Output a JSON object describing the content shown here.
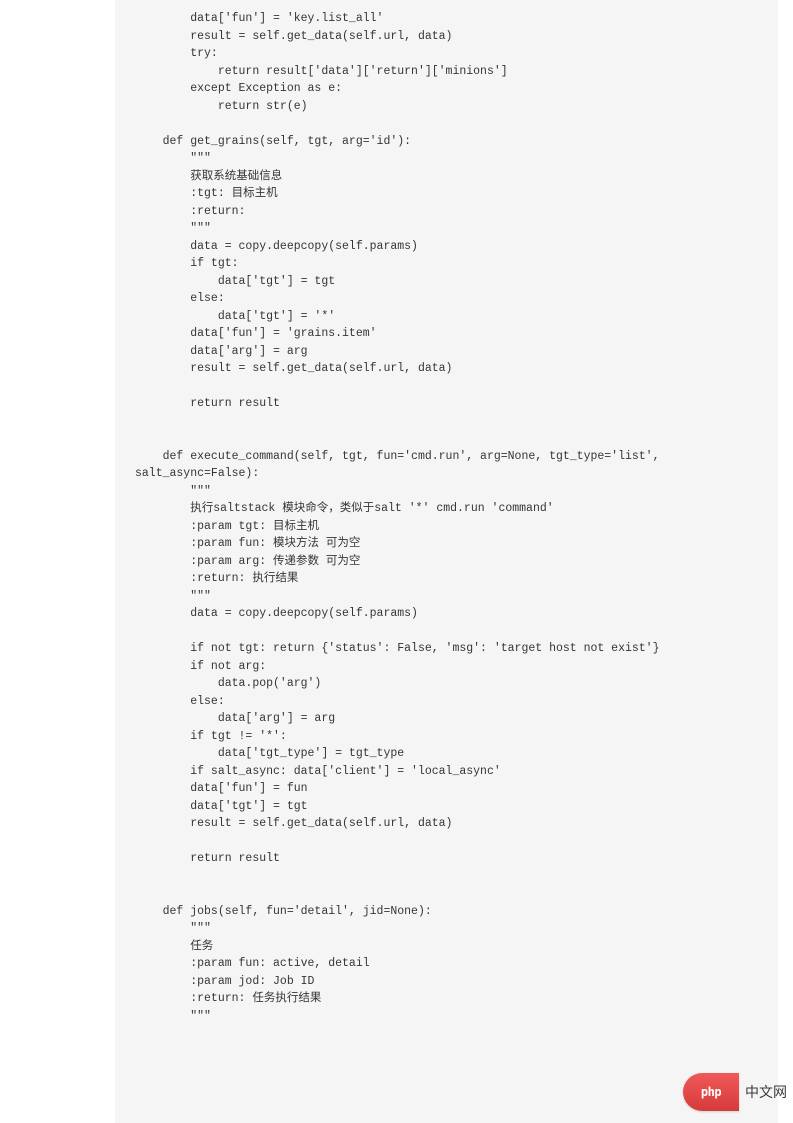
{
  "code": "        data['fun'] = 'key.list_all'\n        result = self.get_data(self.url, data)\n        try:\n            return result['data']['return']['minions']\n        except Exception as e:\n            return str(e)\n\n    def get_grains(self, tgt, arg='id'):\n        \"\"\"\n        获取系统基础信息\n        :tgt: 目标主机\n        :return:\n        \"\"\"\n        data = copy.deepcopy(self.params)\n        if tgt:\n            data['tgt'] = tgt\n        else:\n            data['tgt'] = '*'\n        data['fun'] = 'grains.item'\n        data['arg'] = arg\n        result = self.get_data(self.url, data)\n\n        return result\n\n\n    def execute_command(self, tgt, fun='cmd.run', arg=None, tgt_type='list',\nsalt_async=False):\n        \"\"\"\n        执行saltstack 模块命令，类似于salt '*' cmd.run 'command'\n        :param tgt: 目标主机\n        :param fun: 模块方法 可为空\n        :param arg: 传递参数 可为空\n        :return: 执行结果\n        \"\"\"\n        data = copy.deepcopy(self.params)\n\n        if not tgt: return {'status': False, 'msg': 'target host not exist'}\n        if not arg:\n            data.pop('arg')\n        else:\n            data['arg'] = arg\n        if tgt != '*':\n            data['tgt_type'] = tgt_type\n        if salt_async: data['client'] = 'local_async'\n        data['fun'] = fun\n        data['tgt'] = tgt\n        result = self.get_data(self.url, data)\n\n        return result\n\n\n    def jobs(self, fun='detail', jid=None):\n        \"\"\"\n        任务\n        :param fun: active, detail\n        :param jod: Job ID\n        :return: 任务执行结果\n        \"\"\"",
  "badge": {
    "icon_text": "php",
    "label": "中文网"
  }
}
